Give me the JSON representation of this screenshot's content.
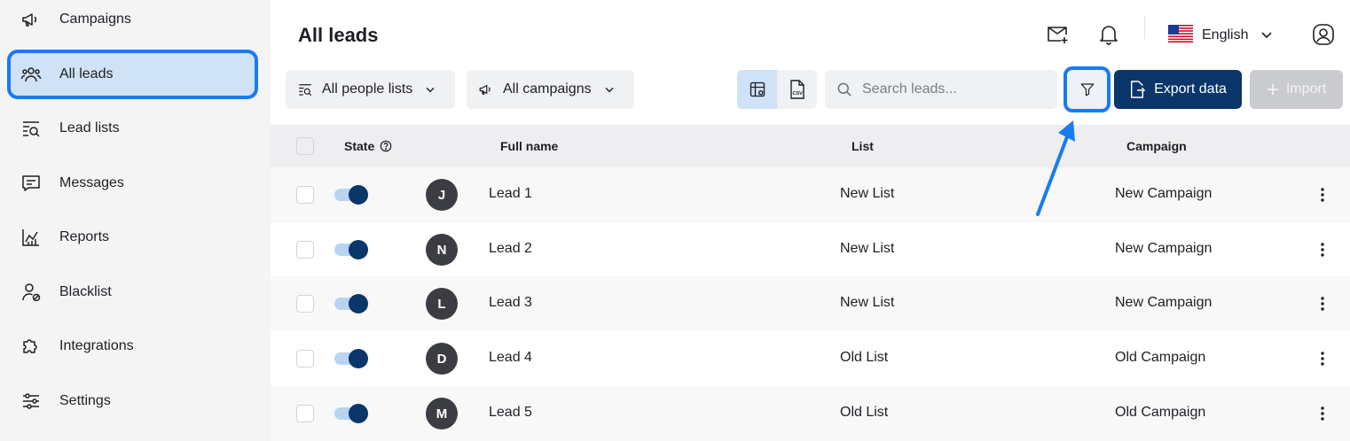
{
  "sidebar": {
    "items": [
      {
        "label": "Campaigns",
        "icon": "megaphone-icon"
      },
      {
        "label": "All leads",
        "icon": "people-icon",
        "active": true
      },
      {
        "label": "Lead lists",
        "icon": "list-search-icon"
      },
      {
        "label": "Messages",
        "icon": "chat-icon"
      },
      {
        "label": "Reports",
        "icon": "chart-icon"
      },
      {
        "label": "Blacklist",
        "icon": "user-blocked-icon"
      },
      {
        "label": "Integrations",
        "icon": "puzzle-icon"
      },
      {
        "label": "Settings",
        "icon": "sliders-icon"
      }
    ]
  },
  "header": {
    "title": "All leads",
    "language": "English"
  },
  "toolbar": {
    "people_lists": "All people lists",
    "campaigns": "All campaigns",
    "search_placeholder": "Search leads...",
    "export_label": "Export data",
    "import_label": "Import"
  },
  "table": {
    "columns": {
      "state": "State",
      "full_name": "Full name",
      "list": "List",
      "campaign": "Campaign"
    },
    "rows": [
      {
        "initial": "J",
        "name": "Lead 1",
        "list": "New List",
        "campaign": "New Campaign",
        "active": true
      },
      {
        "initial": "N",
        "name": "Lead 2",
        "list": "New List",
        "campaign": "New Campaign",
        "active": true
      },
      {
        "initial": "L",
        "name": "Lead 3",
        "list": "New List",
        "campaign": "New Campaign",
        "active": true
      },
      {
        "initial": "D",
        "name": "Lead 4",
        "list": "Old List",
        "campaign": "Old Campaign",
        "active": true
      },
      {
        "initial": "M",
        "name": "Lead 5",
        "list": "Old List",
        "campaign": "Old Campaign",
        "active": true
      }
    ]
  },
  "colors": {
    "accent": "#1a7bf0",
    "primary": "#0a3669",
    "active_bg": "#cfe2f6"
  }
}
